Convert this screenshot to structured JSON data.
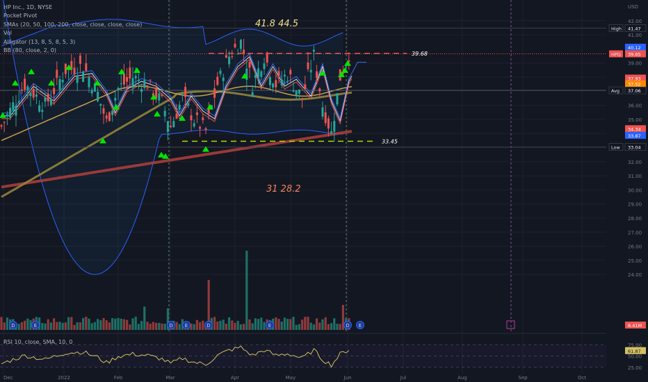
{
  "legend": {
    "symbol": "HP Inc., 1D, NYSE",
    "indicators": [
      "Pocket Pivot",
      "SMAs (20, 50, 100, 200, close, close, close, close)",
      "Vol",
      "Alligator (13, 8, 5, 8, 5, 3)",
      "BB (80, close, 2, 0)"
    ],
    "rsi_label": "RSI 10, close, SMA, 10, 0"
  },
  "annotations": {
    "top_targets": "41.8  44.5",
    "bottom_targets": "31  28.2",
    "resistance_label": "39.68",
    "support_label": "33.45"
  },
  "colors": {
    "background": "#131722",
    "up": "#26a69a",
    "down": "#ef5350",
    "sma200": "#b2403c",
    "sma100": "#9c8b38",
    "bb": "#2962ff",
    "pivot": "#00e600",
    "rsi": "#d4c060"
  },
  "chart_data": {
    "type": "candlestick",
    "y_axis": {
      "label": "USD",
      "ticks": [
        "42.00",
        "41.00",
        "39.00",
        "38.00",
        "36.00",
        "35.00",
        "34.00",
        "33.00",
        "32.00",
        "31.00",
        "30.00",
        "29.00",
        "28.00",
        "27.00",
        "26.00",
        "25.00",
        "24.00"
      ],
      "range": [
        23.5,
        42.5
      ]
    },
    "x_axis": {
      "ticks": [
        "Dec",
        "2022",
        "Feb",
        "Mar",
        "Apr",
        "May",
        "Jun",
        "Jul",
        "Aug",
        "Sep",
        "Oct"
      ]
    },
    "price_badges": [
      {
        "label": "High",
        "value": "41.47"
      },
      {
        "label": "",
        "value": "40.12"
      },
      {
        "label": "HPQ",
        "value": "39.65"
      },
      {
        "label": "",
        "value": "37.93"
      },
      {
        "label": "",
        "value": "37.52"
      },
      {
        "label": "Avg",
        "value": "37.06"
      },
      {
        "label": "",
        "value": "34.34"
      },
      {
        "label": "",
        "value": "33.87"
      },
      {
        "label": "Low",
        "value": "33.04"
      },
      {
        "label": "",
        "value": "8.41M"
      }
    ],
    "rsi": {
      "ticks": [
        "75.00",
        "50.00",
        "25.00"
      ],
      "current": "61.87"
    },
    "levels": {
      "resistance": 39.68,
      "support": 33.45,
      "high": 41.47,
      "low": 33.04
    },
    "events": [
      "D",
      "E",
      "D",
      "E",
      "D",
      "E",
      "D",
      "E"
    ]
  }
}
